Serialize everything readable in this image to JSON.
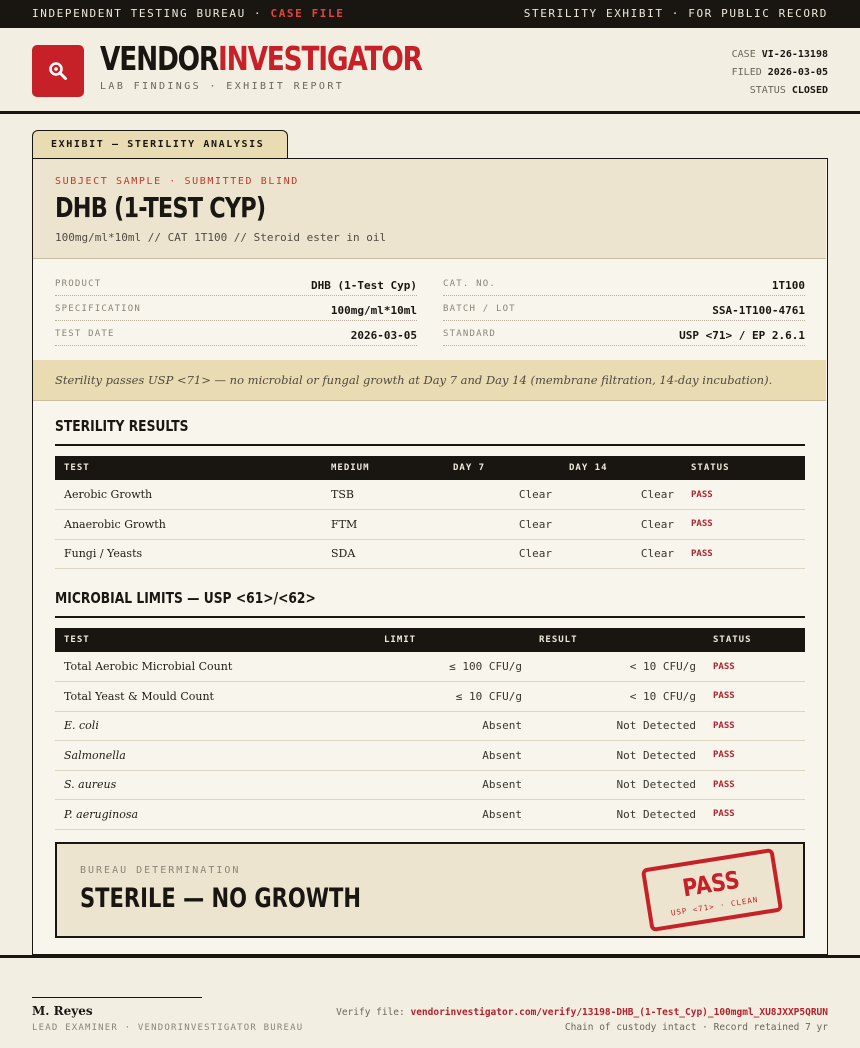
{
  "topbar": {
    "left_prefix": "INDEPENDENT TESTING BUREAU · ",
    "left_highlight": "CASE FILE",
    "right": "STERILITY EXHIBIT · FOR PUBLIC RECORD"
  },
  "brand": {
    "name_part1": "VENDOR",
    "name_part2": "INVESTIGATOR",
    "tagline": "LAB FINDINGS · EXHIBIT REPORT",
    "icon": "magnifier-icon",
    "accent": "#c62128"
  },
  "case_meta": {
    "case_label": "CASE",
    "case_value": "VI-26-13198",
    "filed_label": "FILED",
    "filed_value": "2026-03-05",
    "status_label": "STATUS",
    "status_value": "CLOSED"
  },
  "exhibit_tab": "EXHIBIT — STERILITY ANALYSIS",
  "subject": {
    "kicker": "SUBJECT SAMPLE · SUBMITTED BLIND",
    "title": "DHB (1-TEST CYP)",
    "subtitle": "100mg/ml*10ml  //  CAT 1T100  //  Steroid ester in oil"
  },
  "specs": {
    "left": [
      {
        "label": "PRODUCT",
        "value": "DHB (1-Test Cyp)"
      },
      {
        "label": "SPECIFICATION",
        "value": "100mg/ml*10ml"
      },
      {
        "label": "TEST DATE",
        "value": "2026-03-05"
      }
    ],
    "right": [
      {
        "label": "CAT. NO.",
        "value": "1T100"
      },
      {
        "label": "BATCH / LOT",
        "value": "SSA-1T100-4761"
      },
      {
        "label": "STANDARD",
        "value": "USP <71> / EP 2.6.1"
      }
    ]
  },
  "summary": "Sterility passes USP <71> — no microbial or fungal growth at Day 7 and Day 14 (membrane filtration, 14-day incubation).",
  "sterility": {
    "title": "STERILITY RESULTS",
    "headers": [
      "TEST",
      "MEDIUM",
      "DAY 7",
      "DAY 14",
      "STATUS"
    ],
    "rows": [
      {
        "test": "Aerobic Growth",
        "medium": "TSB",
        "day7": "Clear",
        "day14": "Clear",
        "status": "PASS"
      },
      {
        "test": "Anaerobic Growth",
        "medium": "FTM",
        "day7": "Clear",
        "day14": "Clear",
        "status": "PASS"
      },
      {
        "test": "Fungi / Yeasts",
        "medium": "SDA",
        "day7": "Clear",
        "day14": "Clear",
        "status": "PASS"
      }
    ]
  },
  "microbial": {
    "title": "MICROBIAL LIMITS — USP <61>/<62>",
    "headers": [
      "TEST",
      "LIMIT",
      "RESULT",
      "STATUS"
    ],
    "rows": [
      {
        "test": "Total Aerobic Microbial Count",
        "limit": "≤ 100 CFU/g",
        "result": "< 10 CFU/g",
        "status": "PASS"
      },
      {
        "test": "Total Yeast & Mould Count",
        "limit": "≤ 10 CFU/g",
        "result": "< 10 CFU/g",
        "status": "PASS"
      },
      {
        "test": "E. coli",
        "limit": "Absent",
        "result": "Not Detected",
        "status": "PASS"
      },
      {
        "test": "Salmonella",
        "limit": "Absent",
        "result": "Not Detected",
        "status": "PASS"
      },
      {
        "test": "S. aureus",
        "limit": "Absent",
        "result": "Not Detected",
        "status": "PASS"
      },
      {
        "test": "P. aeruginosa",
        "limit": "Absent",
        "result": "Not Detected",
        "status": "PASS"
      }
    ]
  },
  "determination": {
    "label": "BUREAU DETERMINATION",
    "value": "STERILE — NO GROWTH",
    "stamp_main": "PASS",
    "stamp_sub": "USP <71> · CLEAN"
  },
  "footer": {
    "signer": "M. Reyes",
    "role": "LEAD EXAMINER · VENDORINVESTIGATOR BUREAU",
    "verify_label": "Verify file: ",
    "verify_url": "vendorinvestigator.com/verify/13198-DHB_(1-Test_Cyp)_100mgml_XU8JXXP5QRUN",
    "custody": "Chain of custody intact · Record retained 7 yr"
  }
}
